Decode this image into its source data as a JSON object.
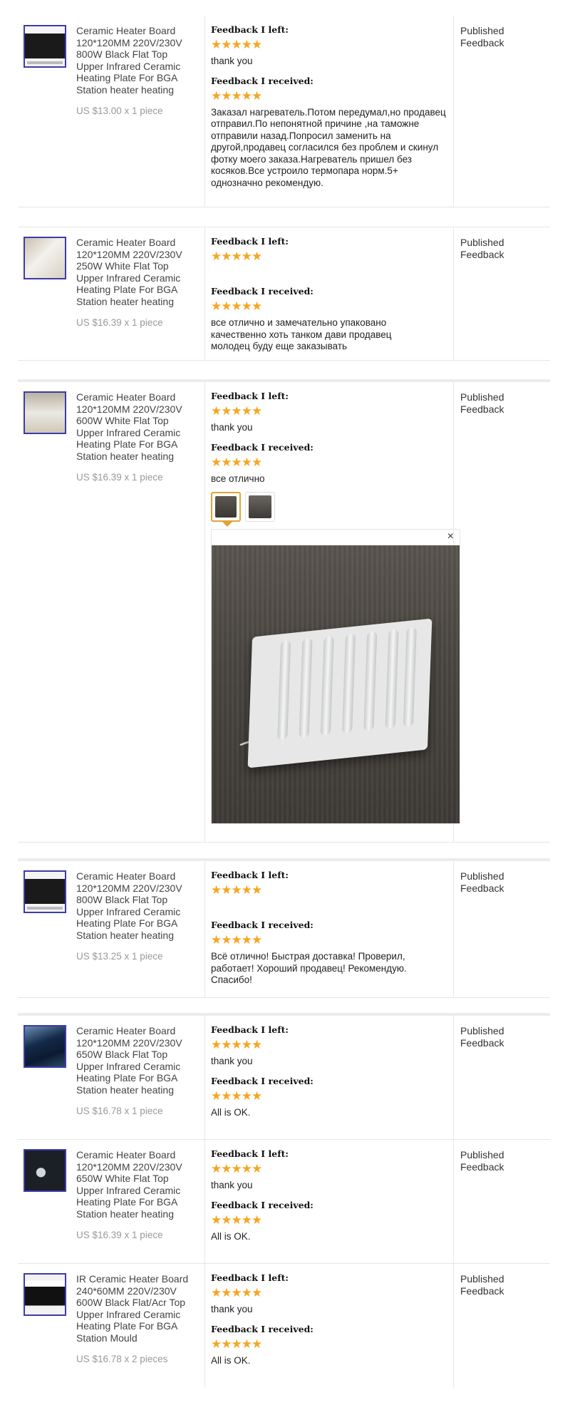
{
  "labels": {
    "left": "Feedback I left:",
    "received": "Feedback I received:",
    "status": "Published Feedback"
  },
  "stars": "★★★★★",
  "orders": [
    {
      "title": "Ceramic Heater Board 120*120MM 220V/230V 800W Black Flat Top Upper Infrared Ceramic Heating Plate For BGA Station heater heating",
      "price": "US $13.00 x 1 piece",
      "left_rating": 5,
      "left_text": "thank you",
      "received_rating": 5,
      "received_text": "Заказал нагреватель.Потом передумал,но продавец отправил.По непонятной причине ,на таможне отправили назад.Попросил заменить на другой,продавец согласился без проблем и скинул фотку моего заказа.Нагреватель пришел без косяков.Все устроило термопара норм.5+ однозначно рекомендую."
    },
    {
      "title": "Ceramic Heater Board 120*120MM 220V/230V 250W White Flat Top Upper Infrared Ceramic Heating Plate For BGA Station heater heating",
      "price": "US $16.39 x 1 piece",
      "left_rating": 5,
      "left_text": "",
      "received_rating": 5,
      "received_text": "все отлично и замечательно упаковано качественно хоть танком дави продавец молодец буду еще заказывать"
    },
    {
      "title": "Ceramic Heater Board 120*120MM 220V/230V 600W White Flat Top Upper Infrared Ceramic Heating Plate For BGA Station heater heating",
      "price": "US $16.39 x 1 piece",
      "left_rating": 5,
      "left_text": "thank you",
      "received_rating": 5,
      "received_text": "все отлично",
      "close_symbol": "×"
    },
    {
      "title": "Ceramic Heater Board 120*120MM 220V/230V 800W Black Flat Top Upper Infrared Ceramic Heating Plate For BGA Station heater heating",
      "price": "US $13.25 x 1 piece",
      "left_rating": 5,
      "left_text": "",
      "received_rating": 5,
      "received_text": "Всё отлично! Быстрая доставка! Проверил, работает! Хороший продавец! Рекомендую. Спасибо!"
    },
    {
      "title": "Ceramic Heater Board 120*120MM 220V/230V 650W Black Flat Top Upper Infrared Ceramic Heating Plate For BGA Station heater heating",
      "price": "US $16.78 x 1 piece",
      "left_rating": 5,
      "left_text": "thank you",
      "received_rating": 5,
      "received_text": "All is OK."
    },
    {
      "title": "Ceramic Heater Board 120*120MM 220V/230V 650W White Flat Top Upper Infrared Ceramic Heating Plate For BGA Station heater heating",
      "price": "US $16.39 x 1 piece",
      "left_rating": 5,
      "left_text": "thank you",
      "received_rating": 5,
      "received_text": "All is OK."
    },
    {
      "title": "IR Ceramic Heater Board 240*60MM 220V/230V 600W Black Flat/Acr Top Upper Infrared Ceramic Heating Plate For BGA Station Mould",
      "price": "US $16.78 x 2 pieces",
      "left_rating": 5,
      "left_text": "thank you",
      "received_rating": 5,
      "received_text": "All is OK."
    }
  ],
  "colors": {
    "star": "#f5a623",
    "thumb_border": "#3c3ca8",
    "selected_photo": "#e0a535"
  }
}
